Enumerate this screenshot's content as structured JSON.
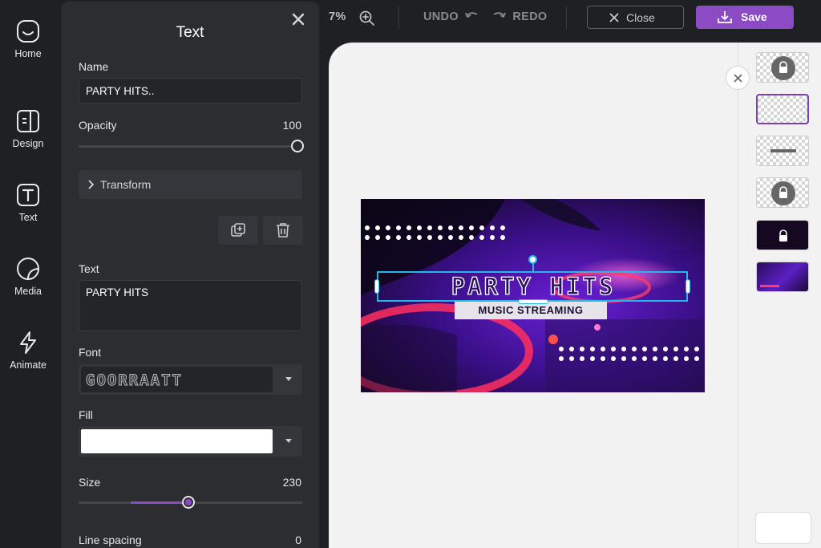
{
  "rail": {
    "items": [
      {
        "label": "Home",
        "icon": "home-icon"
      },
      {
        "label": "Design",
        "icon": "design-icon"
      },
      {
        "label": "Text",
        "icon": "text-icon"
      },
      {
        "label": "Media",
        "icon": "media-icon"
      },
      {
        "label": "Animate",
        "icon": "animate-icon"
      }
    ]
  },
  "panel": {
    "title": "Text",
    "name_label": "Name",
    "name_value": "PARTY HITS..",
    "opacity_label": "Opacity",
    "opacity_value": "100",
    "opacity_fraction": 1.0,
    "transform_label": "Transform",
    "text_label": "Text",
    "text_value": "PARTY HITS",
    "font_label": "Font",
    "font_value": "GOORRAATT",
    "fill_label": "Fill",
    "fill_color": "#ffffff",
    "size_label": "Size",
    "size_value": "230",
    "size_fraction": 0.49,
    "line_spacing_label": "Line spacing",
    "line_spacing_value": "0"
  },
  "topbar": {
    "zoom_text": "7%",
    "undo_label": "UNDO",
    "redo_label": "REDO",
    "close_label": "Close",
    "save_label": "Save"
  },
  "design": {
    "headline": "PARTY HITS",
    "subline": "MUSIC STREAMING"
  },
  "colors": {
    "accent": "#8a4bc4",
    "panel_bg": "#2c2d31",
    "app_bg": "#1f2024",
    "canvas_bg": "#f2f2f3",
    "selection": "#23b8e8"
  }
}
